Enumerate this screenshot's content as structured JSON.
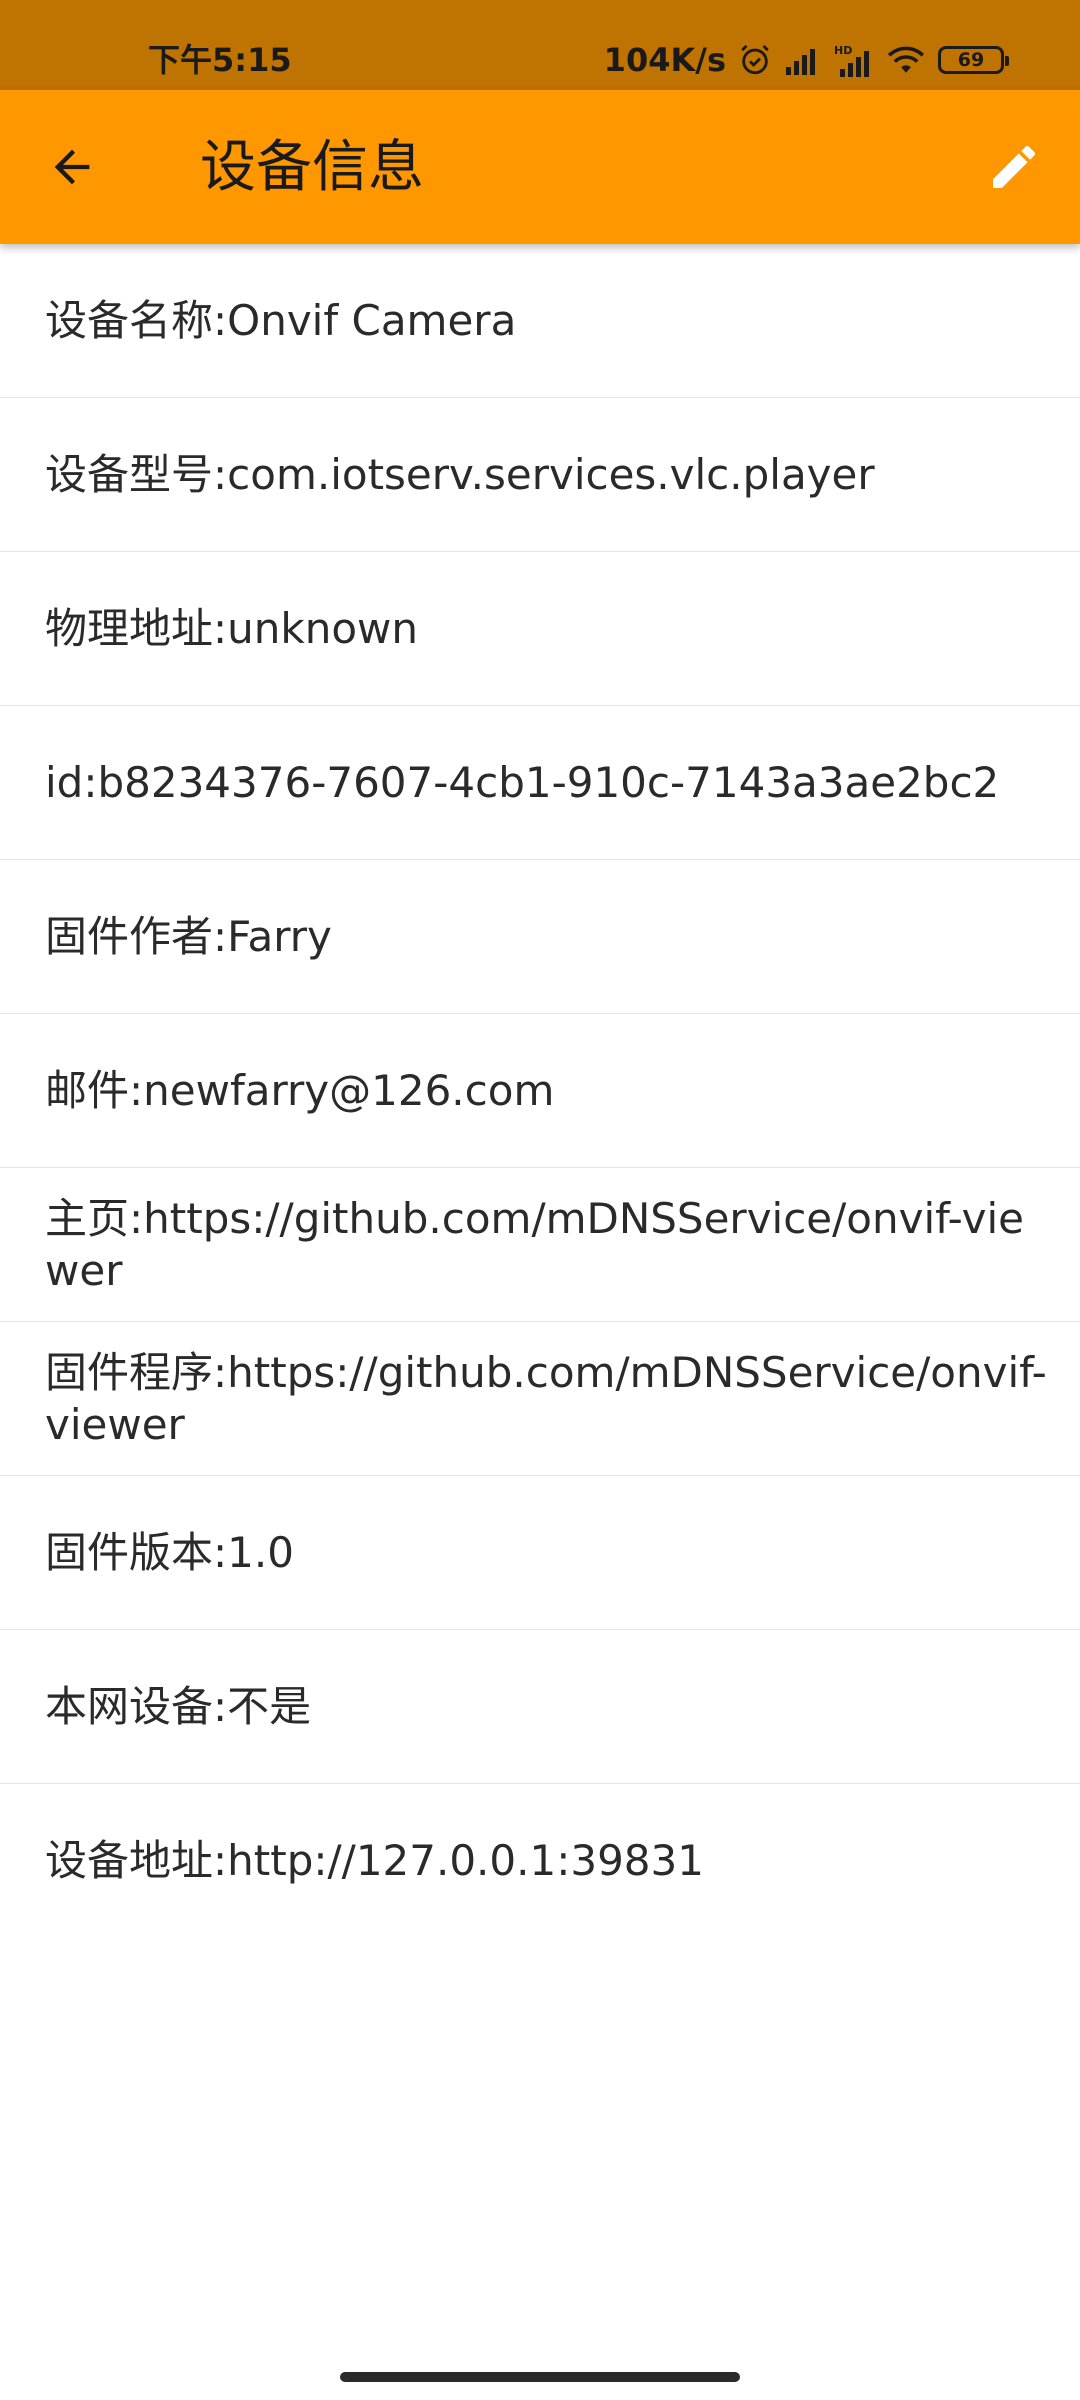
{
  "status_bar": {
    "time": "下午5:15",
    "net_speed": "104K/s",
    "battery": "69",
    "icons": [
      "alarm-icon",
      "signal-icon",
      "hd-signal-icon",
      "wifi-icon",
      "battery-icon"
    ]
  },
  "app_bar": {
    "title": "设备信息",
    "back_icon": "arrow-back-icon",
    "edit_icon": "pencil-icon",
    "color": "#ff9800"
  },
  "info_items": [
    "设备名称:Onvif Camera",
    "设备型号:com.iotserv.services.vlc.player",
    "物理地址:unknown",
    "id:b8234376-7607-4cb1-910c-7143a3ae2bc2",
    "固件作者:Farry",
    "邮件:newfarry@126.com",
    "主页:https://github.com/mDNSService/onvif-viewer",
    "固件程序:https://github.com/mDNSService/onvif-viewer",
    "固件版本:1.0",
    "本网设备:不是",
    "设备地址:http://127.0.0.1:39831"
  ]
}
